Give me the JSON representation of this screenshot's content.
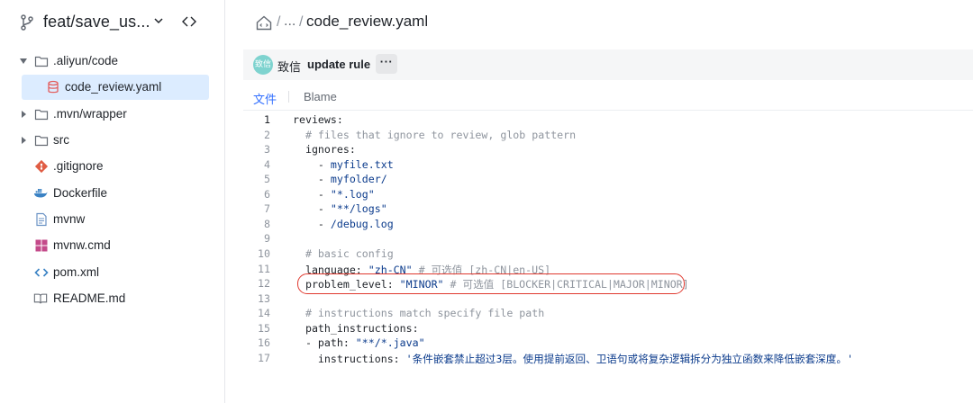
{
  "branch": {
    "name": "feat/save_us..."
  },
  "tree": [
    {
      "label": ".aliyun/code",
      "type": "folder",
      "expanded": true,
      "icon": "folder-icon"
    },
    {
      "label": "code_review.yaml",
      "type": "file",
      "selected": true,
      "icon": "database-file-icon"
    },
    {
      "label": ".mvn/wrapper",
      "type": "folder",
      "expanded": false,
      "icon": "folder-icon"
    },
    {
      "label": "src",
      "type": "folder",
      "expanded": false,
      "icon": "folder-icon"
    },
    {
      "label": ".gitignore",
      "type": "file",
      "icon": "git-icon"
    },
    {
      "label": "Dockerfile",
      "type": "file",
      "icon": "docker-icon"
    },
    {
      "label": "mvnw",
      "type": "file",
      "icon": "text-file-icon"
    },
    {
      "label": "mvnw.cmd",
      "type": "file",
      "icon": "windows-icon"
    },
    {
      "label": "pom.xml",
      "type": "file",
      "icon": "code-icon"
    },
    {
      "label": "README.md",
      "type": "file",
      "icon": "book-icon"
    }
  ],
  "breadcrumb": {
    "sep": "/",
    "ellipsis": "...",
    "file": "code_review.yaml"
  },
  "commit": {
    "avatar_text": "致信",
    "author": "致信",
    "message": "update rule",
    "more": "···"
  },
  "tabs": {
    "file": "文件",
    "blame": "Blame"
  },
  "code": {
    "active_line": 1,
    "lines": [
      {
        "n": "1",
        "text": "reviews:"
      },
      {
        "n": "2",
        "text": "  # files that ignore to review, glob pattern"
      },
      {
        "n": "3",
        "text": "  ignores:"
      },
      {
        "n": "4",
        "text": "    - myfile.txt"
      },
      {
        "n": "5",
        "text": "    - myfolder/"
      },
      {
        "n": "6",
        "text": "    - \"*.log\""
      },
      {
        "n": "7",
        "text": "    - \"**/logs\""
      },
      {
        "n": "8",
        "text": "    - /debug.log"
      },
      {
        "n": "9",
        "text": ""
      },
      {
        "n": "10",
        "text": "  # basic config"
      },
      {
        "n": "11",
        "text": "  language: \"zh-CN\" # 可选值 [zh-CN|en-US]"
      },
      {
        "n": "12",
        "text": "  problem_level: \"MINOR\" # 可选值 [BLOCKER|CRITICAL|MAJOR|MINOR]"
      },
      {
        "n": "13",
        "text": ""
      },
      {
        "n": "14",
        "text": "  # instructions match specify file path"
      },
      {
        "n": "15",
        "text": "  path_instructions:"
      },
      {
        "n": "16",
        "text": "  - path: \"**/*.java\""
      },
      {
        "n": "17",
        "text": "    instructions: '条件嵌套禁止超过3层。使用提前返回、卫语句或将复杂逻辑拆分为独立函数来降低嵌套深度。'"
      }
    ]
  },
  "colors": {
    "accent": "#3370ff",
    "highlight_ring": "#e0392f",
    "selected_row": "#dcecff"
  }
}
